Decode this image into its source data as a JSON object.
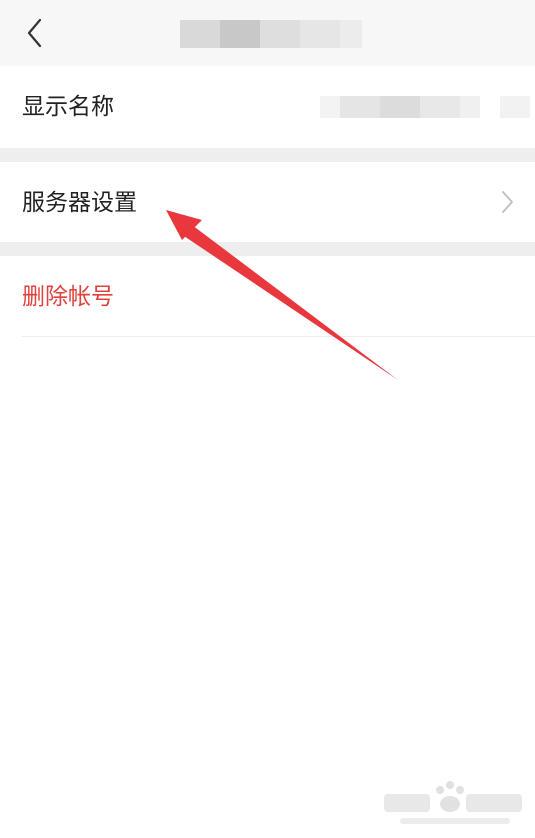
{
  "navbar": {
    "back_icon": "chevron-left-icon"
  },
  "settings": {
    "display_name_label": "显示名称",
    "server_settings_label": "服务器设置",
    "delete_account_label": "删除帐号"
  },
  "icons": {
    "row_chevron": "chevron-right-icon"
  },
  "colors": {
    "navbar_bg": "#f7f7f7",
    "separator": "#eeeeee",
    "danger_text": "#e0413c",
    "annotation_arrow": "#e8383d"
  }
}
